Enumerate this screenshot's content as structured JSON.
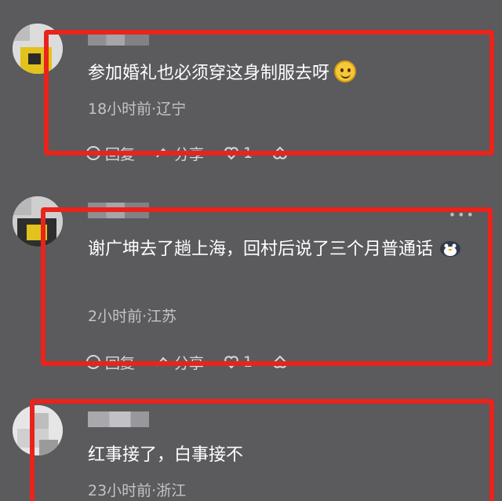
{
  "comments": [
    {
      "text": "参加婚礼也必须穿这身制服去呀",
      "meta": "18小时前·辽宁",
      "reply_label": "回复",
      "share_label": "分享",
      "like_count": "1"
    },
    {
      "text": "谢广坤去了趟上海，回村后说了三个月普通话",
      "meta": "2小时前·江苏",
      "reply_label": "回复",
      "share_label": "分享",
      "like_count": "1"
    },
    {
      "text": "红事接了，白事接不",
      "meta": "23小时前·浙江"
    }
  ],
  "colors": {
    "highlight": "#e8241c",
    "background": "#5b5a5d"
  },
  "icons": [
    "smile-emoji-icon",
    "bird-emoji-icon",
    "reply-icon",
    "share-icon",
    "heart-icon",
    "dislike-icon",
    "more-icon"
  ]
}
